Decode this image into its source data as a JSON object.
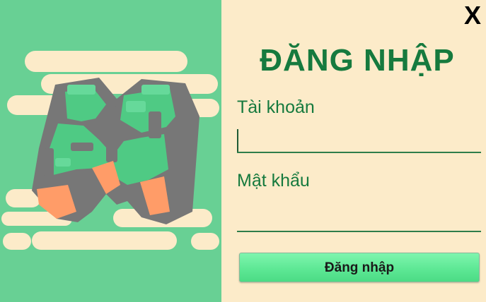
{
  "window": {
    "close_label": "X"
  },
  "login_form": {
    "title": "ĐĂNG NHẬP",
    "username_label": "Tài khoản",
    "username_value": "",
    "password_label": "Mật khẩu",
    "password_value": "",
    "submit_label": "Đăng nhập"
  },
  "logo": {
    "icon": "minecraft-launcher-logo-icon"
  },
  "colors": {
    "left_panel_bg": "#68d094",
    "right_panel_bg": "#fcebc9",
    "title_text": "#167a3e",
    "button_green": "#5ee895",
    "logo_gray": "#777777",
    "logo_orange": "#ff9c68"
  }
}
